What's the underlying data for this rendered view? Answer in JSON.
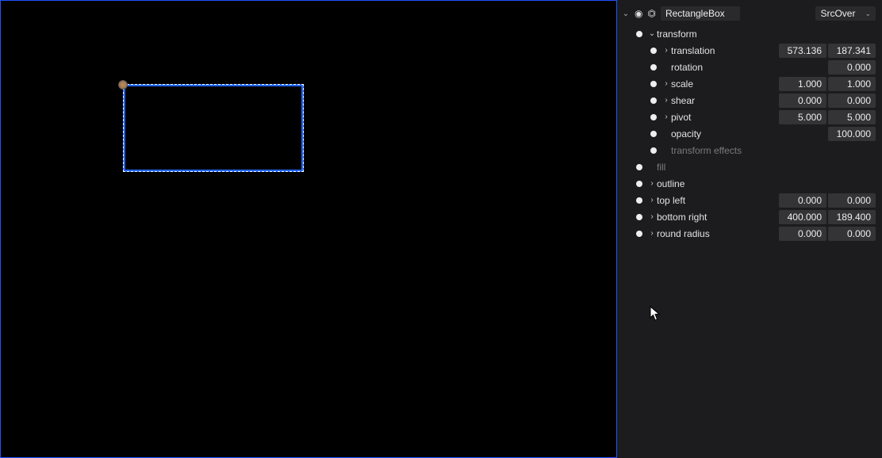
{
  "viewport": {
    "object_name": "RectangleBox"
  },
  "inspector": {
    "header": {
      "name": "RectangleBox",
      "blend_mode": "SrcOver"
    },
    "rows": [
      {
        "indent": 0,
        "expand": "open",
        "label": "transform",
        "dim": false,
        "vals": []
      },
      {
        "indent": 1,
        "expand": "closed",
        "label": "translation",
        "dim": false,
        "vals": [
          "573.136",
          "187.341"
        ]
      },
      {
        "indent": 1,
        "expand": "none",
        "label": "rotation",
        "dim": false,
        "vals": [
          "0.000"
        ]
      },
      {
        "indent": 1,
        "expand": "closed",
        "label": "scale",
        "dim": false,
        "vals": [
          "1.000",
          "1.000"
        ]
      },
      {
        "indent": 1,
        "expand": "closed",
        "label": "shear",
        "dim": false,
        "vals": [
          "0.000",
          "0.000"
        ]
      },
      {
        "indent": 1,
        "expand": "closed",
        "label": "pivot",
        "dim": false,
        "vals": [
          "5.000",
          "5.000"
        ]
      },
      {
        "indent": 1,
        "expand": "none",
        "label": "opacity",
        "dim": false,
        "vals": [
          "100.000"
        ]
      },
      {
        "indent": 1,
        "expand": "none",
        "label": "transform effects",
        "dim": true,
        "vals": []
      },
      {
        "indent": 0,
        "expand": "none",
        "label": "fill",
        "dim": true,
        "vals": []
      },
      {
        "indent": 0,
        "expand": "closed",
        "label": "outline",
        "dim": false,
        "vals": []
      },
      {
        "indent": 0,
        "expand": "closed",
        "label": "top left",
        "dim": false,
        "vals": [
          "0.000",
          "0.000"
        ]
      },
      {
        "indent": 0,
        "expand": "closed",
        "label": "bottom right",
        "dim": false,
        "vals": [
          "400.000",
          "189.400"
        ]
      },
      {
        "indent": 0,
        "expand": "closed",
        "label": "round radius",
        "dim": false,
        "vals": [
          "0.000",
          "0.000"
        ]
      }
    ]
  }
}
